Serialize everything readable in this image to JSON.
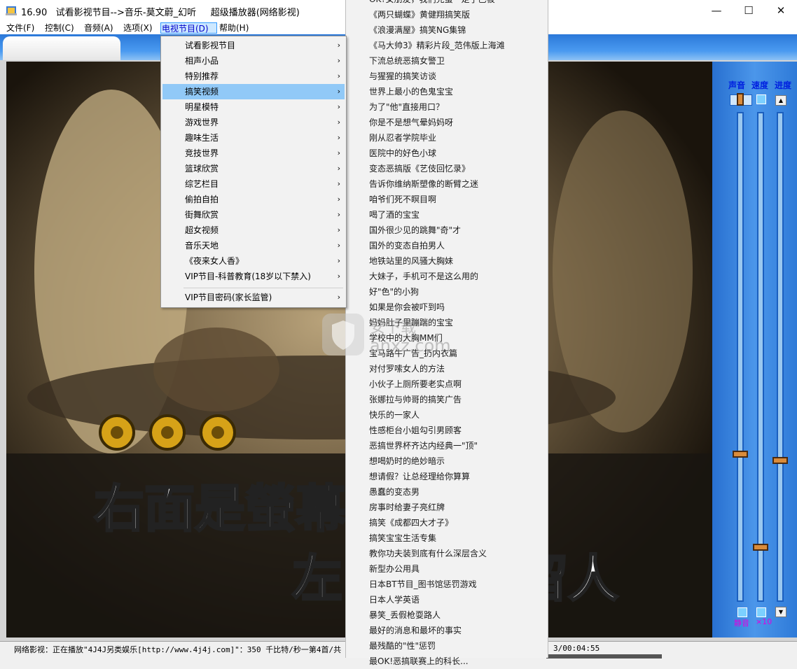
{
  "window": {
    "title": "16.90   试看影视节目-->音乐-莫文蔚_幻听     超级播放器(网络影视)",
    "minimize": "—",
    "maximize": "☐",
    "close": "✕"
  },
  "menubar": {
    "items": [
      "文件(F)",
      "控制(C)",
      "音频(A)",
      "选项(X)",
      "电视节目(D)",
      "帮助(H)"
    ]
  },
  "video": {
    "subtitle_line1": "右面是螢幕",
    "subtitle_line2a": "左",
    "subtitle_line2b": "留人"
  },
  "side_panel": {
    "volume_label": "声音",
    "speed_label": "速度",
    "progress_label": "进度",
    "mute_label": "静音",
    "speed_mult_label": "×10",
    "up_arrow": "▲",
    "down_arrow": "▼"
  },
  "dropdown": {
    "items": [
      {
        "label": "试看影视节目"
      },
      {
        "label": "相声小品"
      },
      {
        "label": "特别推荐"
      },
      {
        "label": "搞笑视频"
      },
      {
        "label": "明星模特"
      },
      {
        "label": "游戏世界"
      },
      {
        "label": "趣味生活"
      },
      {
        "label": "竞技世界"
      },
      {
        "label": "篮球欣赏"
      },
      {
        "label": "综艺栏目"
      },
      {
        "label": "偷拍自拍"
      },
      {
        "label": "街舞欣赏"
      },
      {
        "label": "超女视频"
      },
      {
        "label": "音乐天地"
      },
      {
        "label": "《夜来女人香》"
      },
      {
        "label": "VIP节目-科普教育(18岁以下禁入)"
      },
      {
        "label": "VIP节目密码(家长监管)"
      }
    ],
    "arrow": "›"
  },
  "submenu": {
    "items": [
      "OK?女朋友，我们完蛋一定了巴被",
      "《两只蝴蝶》黄健翔搞笑版",
      "《浪漫满屋》搞笑NG集锦",
      "《马大帅3》精彩片段_范伟版上海滩",
      "下流总统恶搞女警卫",
      "与猩猩的搞笑访谈",
      "世界上最小的色鬼宝宝",
      "为了\"他\"直接用口？",
      "你是不是想气晕妈妈呀",
      "刚从忍者学院毕业",
      "医院中的好色小球",
      "变态恶搞版《艺伎回忆录》",
      "告诉你维纳斯塑像的断臂之迷",
      "咱爷们死不瞑目啊",
      "喝了酒的宝宝",
      "国外很少见的跳舞\"奇\"才",
      "国外的变态自拍男人",
      "地铁站里的风骚大胸妹",
      "大妹子，手机可不是这么用的",
      "好\"色\"的小狗",
      "如果是你会被吓到吗",
      "妈妈肚子里蹦踹的宝宝",
      "学校中的大胸MM们",
      "宝马路牛广告_扔内衣篇",
      "对付罗嗦女人的方法",
      "小伙子上厕所要老实点啊",
      "张娜拉与帅哥的搞笑广告",
      "快乐的一家人",
      "性感柜台小姐勾引男顾客",
      "恶搞世界杯齐达内经典一\"顶\"",
      "想喝奶时的绝妙暗示",
      "想请假？让总经理给你算算",
      "愚蠢的变态男",
      "房事时给妻子亮红牌",
      "搞笑《成都四大才子》",
      "搞笑宝宝生活专集",
      "教你功夫装到底有什么深层含义",
      "新型办公用具",
      "日本BT节目_图书馆惩罚游戏",
      "日本人学英语",
      "暴笑_丢假枪耍路人",
      "最好的消息和最坏的事实",
      "最残酷的\"性\"惩罚",
      "最OK!恶搞联赛上的科长..."
    ]
  },
  "status": {
    "text": "网络影视：正在播放\"4J4J另类娱乐[http://www.4j4j.com]\"：350 千比特/秒一第4首/共",
    "time": "3/00:04:55"
  },
  "watermark": {
    "text": "安下载",
    "domain": "anxz.com"
  },
  "colors": {
    "accent": "#2b78d8",
    "highlight": "#91c9f7",
    "panel_label": "#0020e0",
    "mute_label": "#e000e0"
  }
}
